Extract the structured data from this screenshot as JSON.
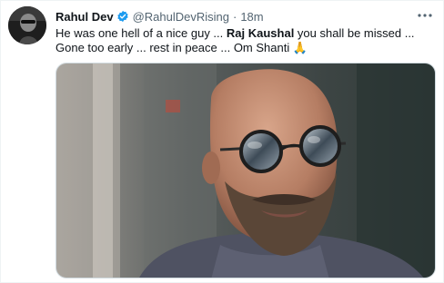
{
  "tweet": {
    "author_name": "Rahul Dev",
    "handle": "@RahulDevRising",
    "separator": "·",
    "time": "18m",
    "text_part1": "He was one hell of a nice guy ... ",
    "text_bold": "Raj Kaushal",
    "text_part2": " you shall be missed ... Gone too early ... rest in peace ... Om Shanti 🙏",
    "icons": {
      "verified": "verified-badge-icon",
      "more": "more-options-icon"
    }
  },
  "colors": {
    "verified_blue": "#1d9bf0",
    "text_primary": "#0f1419",
    "text_secondary": "#536471"
  }
}
